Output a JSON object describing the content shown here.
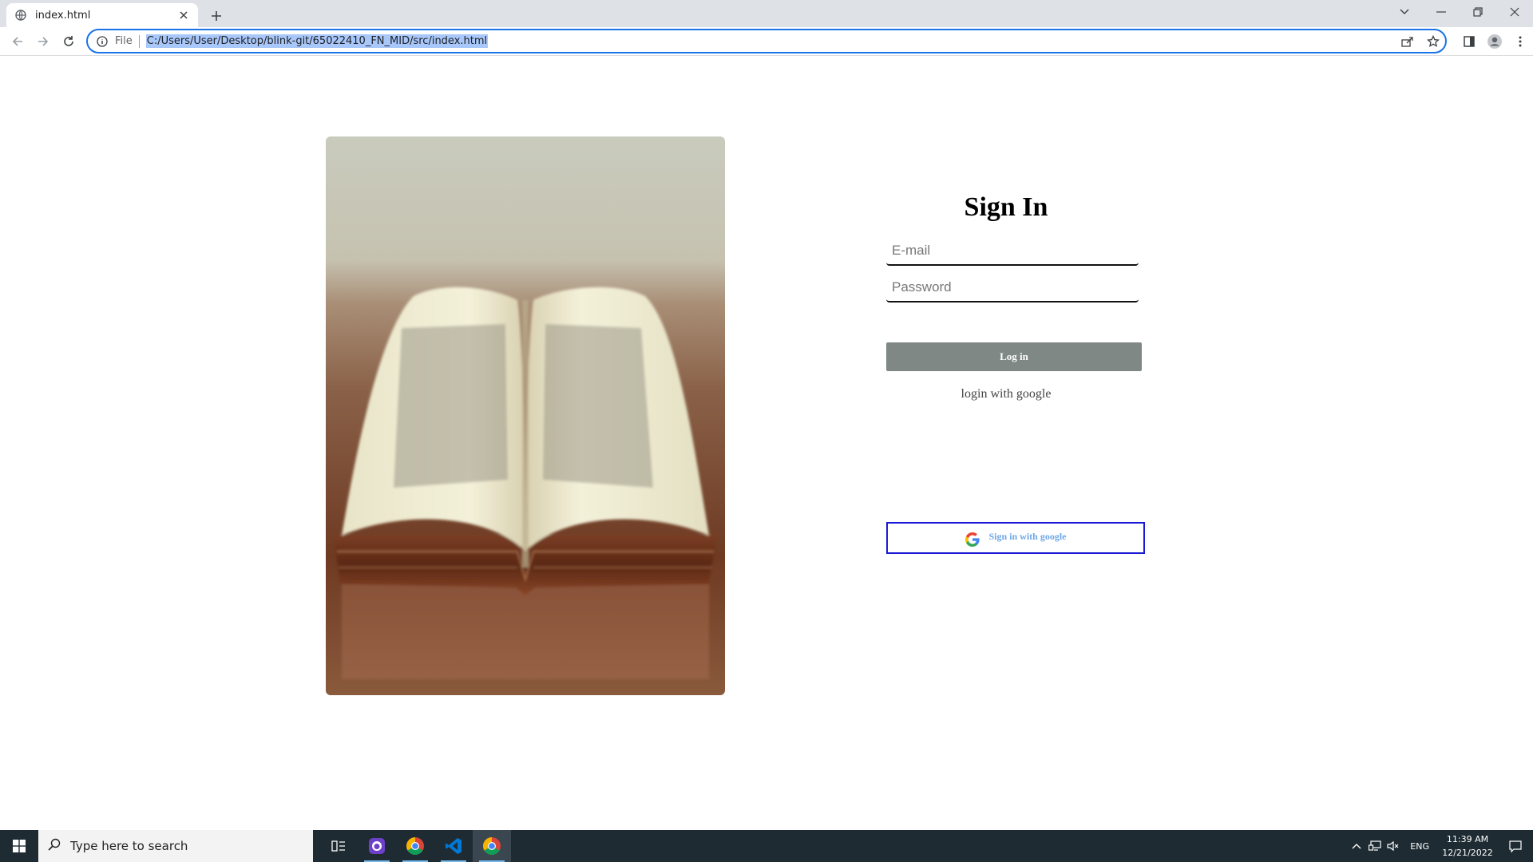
{
  "browser": {
    "tab_title": "index.html",
    "file_label": "File",
    "url": "C:/Users/User/Desktop/blink-git/65022410_FN_MID/src/index.html"
  },
  "page": {
    "heading": "Sign In",
    "email_placeholder": "E-mail",
    "password_placeholder": "Password",
    "login_button": "Log in",
    "alt_label": "login with google",
    "google_button": "Sign in with google"
  },
  "taskbar": {
    "search_placeholder": "Type here to search",
    "language": "ENG",
    "time": "11:39 AM",
    "date": "12/21/2022"
  },
  "colors": {
    "login_button_bg": "#7f8884",
    "google_button_border": "#1a1ad6",
    "google_button_text": "#6ea8ea",
    "omnibox_focus": "#1a73e8"
  }
}
